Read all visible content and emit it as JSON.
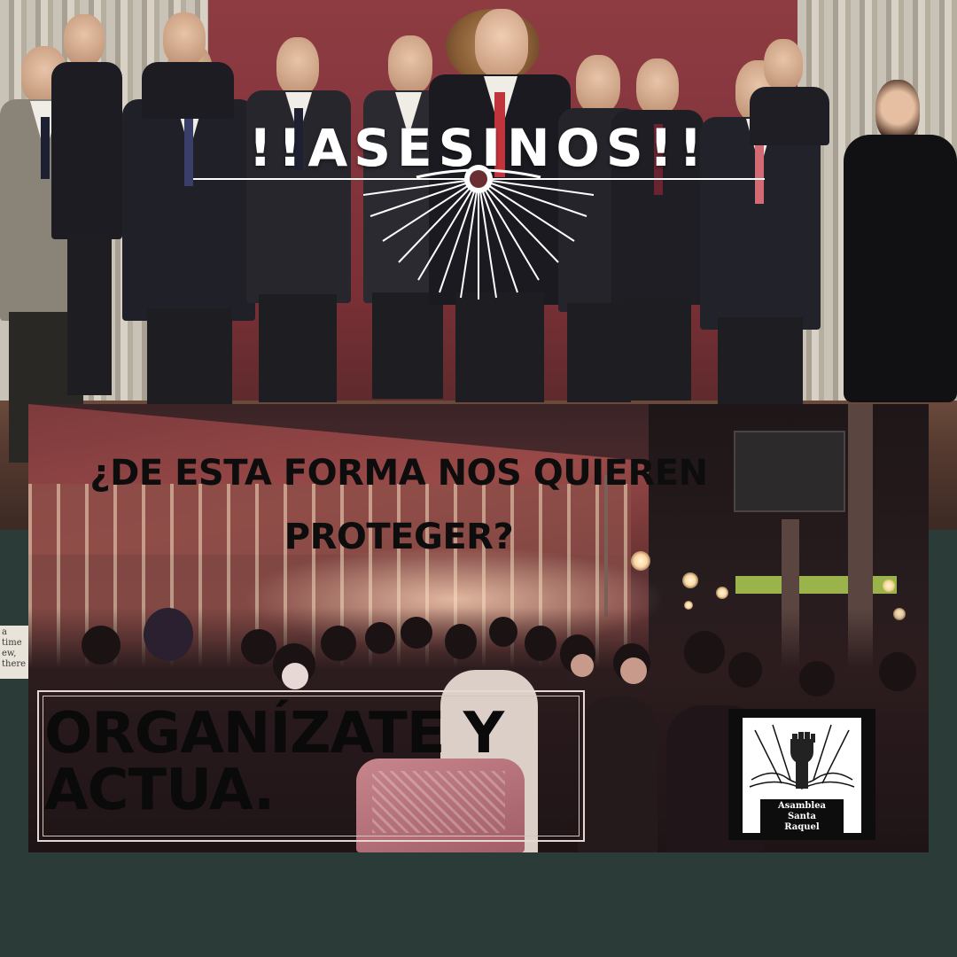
{
  "poster": {
    "headline": "!!ASESINOS!!",
    "question_line1": "¿DE ESTA FORMA NOS QUIEREN",
    "question_line2": "PROTEGER?",
    "cta_line1": "ORGANÍZATE Y",
    "cta_line2": "ACTUA."
  },
  "logo": {
    "line1": "Asamblea",
    "line2": "Santa",
    "line3": "Raquel"
  },
  "scrap": {
    "line1": "a time",
    "line2": "ew, there"
  },
  "colors": {
    "background": "#2a3b38",
    "headline_text": "#ffffff",
    "body_text": "#0d0d0d",
    "logo_bg": "#0d0d0d"
  }
}
